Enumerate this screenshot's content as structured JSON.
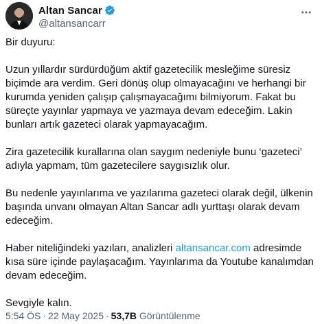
{
  "author": {
    "display_name": "Altan Sancar",
    "handle": "@altansancarr",
    "verified": true,
    "verified_color": "#1d9bf0",
    "avatar_icon": "profile-photo"
  },
  "more_icon": "more-horizontal-icon",
  "post": {
    "p1": "Bir duyuru:",
    "p2": "Uzun yıllardır sürdürdüğüm aktif gazetecilik mesleğime süresiz biçimde ara verdim. Geri dönüş olup olmayacağını ve herhangi bir kurumda yeniden çalışıp çalışmayacağımı bilmiyorum. Fakat bu süreçte yayınlar yapmaya ve yazmaya devam edeceğim. Lakin bunları artık gazeteci olarak yapmayacağım.",
    "p3": "Zira gazetecilik kurallarına olan saygım nedeniyle bunu ‘gazeteci’ adıyla yapmam, tüm gazetecilere saygısızlık olur.",
    "p4": "Bu nedenle yayınlarıma ve yazılarıma gazeteci olarak değil, ülkenin başında unvanı olmayan Altan Sancar adlı yurttaşı olarak devam edeceğim.",
    "p5_before": "Haber niteliğindeki yazıları, analizleri ",
    "p5_link": "altansancar.com",
    "p5_after": " adresimde kısa süre içinde paylaşacağım. Yayınlarıma da Youtube kanalımdan devam edeceğim.",
    "p6": "Sevgiyle kalın.",
    "link_color": "#1d9bf0"
  },
  "meta": {
    "time": "5:54 ÖS",
    "date": "22 May 2025",
    "views": "53,7B",
    "views_label": "Görüntülenme"
  }
}
